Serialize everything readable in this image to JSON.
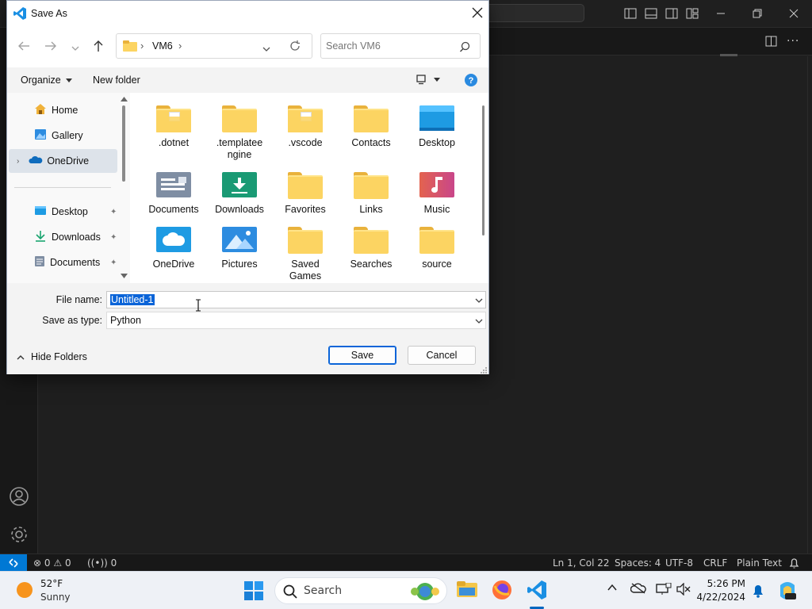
{
  "vscode": {
    "status": {
      "errors": "0",
      "warnings": "0",
      "ports": "0",
      "position": "Ln 1, Col 22",
      "spaces": "Spaces: 4",
      "encoding": "UTF-8",
      "eol": "CRLF",
      "language": "Plain Text"
    },
    "accent": "#0078d4"
  },
  "dialog": {
    "title": "Save As",
    "address": [
      "VM6"
    ],
    "search_placeholder": "Search VM6",
    "organize": "Organize",
    "new_folder": "New folder",
    "nav": {
      "top": [
        {
          "label": "Home",
          "icon": "home-icon"
        },
        {
          "label": "Gallery",
          "icon": "gallery-icon"
        },
        {
          "label": "OneDrive",
          "icon": "cloud-icon"
        }
      ],
      "pinned": [
        {
          "label": "Desktop",
          "icon": "desktop-icon"
        },
        {
          "label": "Downloads",
          "icon": "download-icon"
        },
        {
          "label": "Documents",
          "icon": "documents-icon"
        }
      ]
    },
    "folders": [
      {
        "label": ".dotnet",
        "kind": "plain-doc"
      },
      {
        "label": ".templatee ngine",
        "kind": "plain"
      },
      {
        "label": ".vscode",
        "kind": "plain-doc"
      },
      {
        "label": "Contacts",
        "kind": "plain"
      },
      {
        "label": "Desktop",
        "kind": "desktop"
      },
      {
        "label": "Documents",
        "kind": "documents"
      },
      {
        "label": "Downloads",
        "kind": "downloads"
      },
      {
        "label": "Favorites",
        "kind": "plain"
      },
      {
        "label": "Links",
        "kind": "plain"
      },
      {
        "label": "Music",
        "kind": "music"
      },
      {
        "label": "OneDrive",
        "kind": "onedrive"
      },
      {
        "label": "Pictures",
        "kind": "pictures"
      },
      {
        "label": "Saved Games",
        "kind": "plain"
      },
      {
        "label": "Searches",
        "kind": "plain"
      },
      {
        "label": "source",
        "kind": "plain"
      }
    ],
    "file_name_label": "File name:",
    "file_name_value": "Untitled-1",
    "save_type_label": "Save as type:",
    "save_type_value": "Python",
    "hide_folders": "Hide Folders",
    "save": "Save",
    "cancel": "Cancel"
  },
  "taskbar": {
    "weather_temp": "52°F",
    "weather_desc": "Sunny",
    "search": "Search",
    "time": "5:26 PM",
    "date": "4/22/2024"
  }
}
